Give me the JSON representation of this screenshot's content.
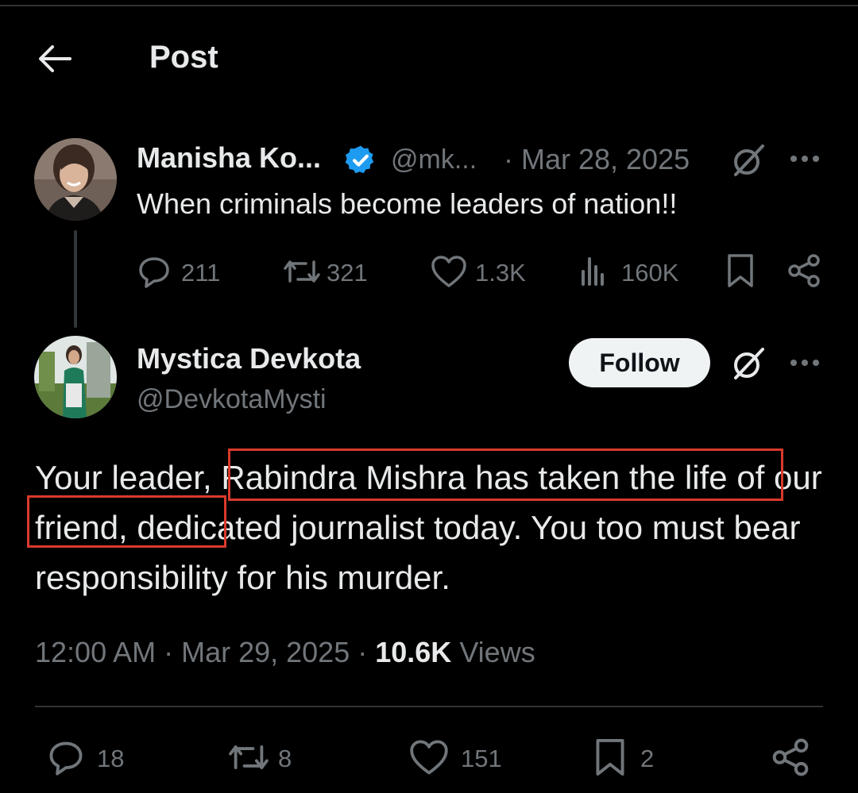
{
  "header": {
    "title": "Post"
  },
  "parent_post": {
    "name": "Manisha Ko...",
    "handle": "@mk...",
    "date": "· Mar 28, 2025",
    "text": "When criminals become leaders of nation!!",
    "actions": {
      "replies": "211",
      "reposts": "321",
      "likes": "1.3K",
      "views": "160K"
    }
  },
  "main_post": {
    "name": "Mystica Devkota",
    "handle": "@DevkotaMysti",
    "follow_label": "Follow",
    "text_parts": [
      "Your leader, ",
      "Rabindra Mishra has taken the life",
      " of ",
      "our friend, d",
      "edicated journalist today. You too must bear responsibility for his murder."
    ],
    "timestamp": "12:00 AM · Mar 29, 2025 · ",
    "views_count": "10.6K",
    "views_label": " Views",
    "actions": {
      "replies": "18",
      "reposts": "8",
      "likes": "151",
      "bookmarks": "2"
    }
  },
  "colors": {
    "background": "#000000",
    "text": "#e7e9ea",
    "muted": "#71767b",
    "verified": "#1d9bf0",
    "highlight_box": "#d93a2b"
  }
}
